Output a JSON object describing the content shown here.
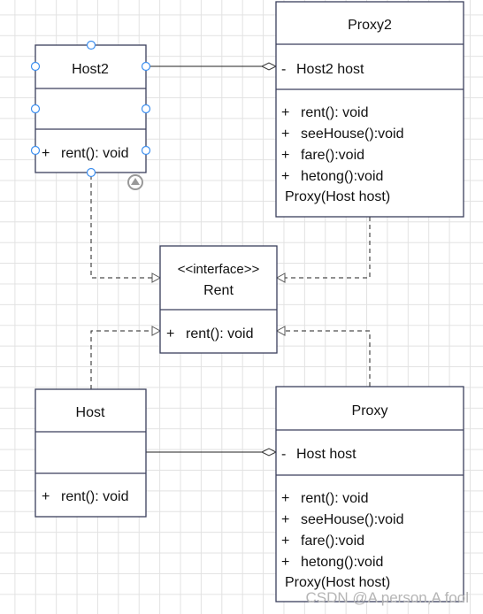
{
  "classes": {
    "host2": {
      "name": "Host2",
      "methods": [
        "+",
        "rent(): void"
      ]
    },
    "proxy2": {
      "name": "Proxy2",
      "attribute": {
        "vis": "-",
        "text": "Host2 host"
      },
      "methods": [
        {
          "vis": "+",
          "text": "rent(): void"
        },
        {
          "vis": "+",
          "text": "seeHouse():void"
        },
        {
          "vis": "+",
          "text": "fare():void"
        },
        {
          "vis": "+",
          "text": "hetong():void"
        }
      ],
      "constructor": "Proxy(Host host)"
    },
    "rent": {
      "stereotype": "<<interface>>",
      "name": "Rent",
      "method": {
        "vis": "+",
        "text": "rent(): void"
      }
    },
    "host": {
      "name": "Host",
      "method": {
        "vis": "+",
        "text": "rent(): void"
      }
    },
    "proxy": {
      "name": "Proxy",
      "attribute": {
        "vis": "-",
        "text": "Host host"
      },
      "methods": [
        {
          "vis": "+",
          "text": "rent(): void"
        },
        {
          "vis": "+",
          "text": "seeHouse():void"
        },
        {
          "vis": "+",
          "text": "fare():void"
        },
        {
          "vis": "+",
          "text": "hetong():void"
        }
      ],
      "constructor": "Proxy(Host host)"
    }
  },
  "relations": [
    {
      "type": "aggregation",
      "from": "Proxy2",
      "to": "Host2"
    },
    {
      "type": "aggregation",
      "from": "Proxy",
      "to": "Host"
    },
    {
      "type": "realization",
      "from": "Host2",
      "to": "Rent"
    },
    {
      "type": "realization",
      "from": "Proxy2",
      "to": "Rent"
    },
    {
      "type": "realization",
      "from": "Host",
      "to": "Rent"
    },
    {
      "type": "realization",
      "from": "Proxy",
      "to": "Rent"
    }
  ],
  "colors": {
    "border": "#3a3f5c",
    "handle": "#3d8fef",
    "grid": "#e2e2e2"
  },
  "watermark": "CSDN @A person,A fool"
}
